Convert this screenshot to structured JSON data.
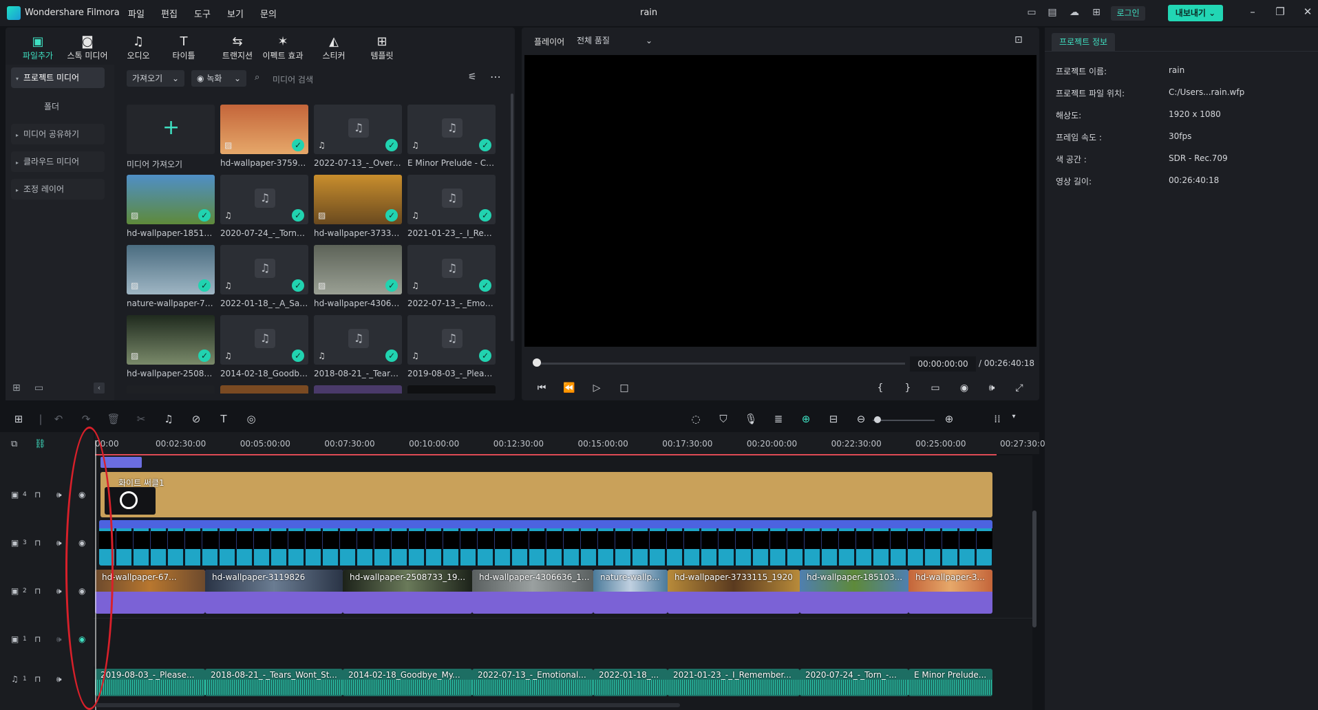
{
  "titlebar": {
    "app_name": "Wondershare Filmora",
    "menus": [
      "파일",
      "편집",
      "도구",
      "보기",
      "문의"
    ],
    "project_title": "rain",
    "login": "로그인",
    "export": "내보내기 ⌄"
  },
  "media_tabs": [
    {
      "label": "파일추가",
      "icon": "media-icon",
      "glyph": "▣"
    },
    {
      "label": "스톡 미디어",
      "icon": "stock-icon",
      "glyph": "◙"
    },
    {
      "label": "오디오",
      "icon": "music-icon",
      "glyph": "♫"
    },
    {
      "label": "타이틀",
      "icon": "title-icon",
      "glyph": "T"
    },
    {
      "label": "트랜지션",
      "icon": "transition-icon",
      "glyph": "⇆"
    },
    {
      "label": "이펙트 효과",
      "icon": "effects-icon",
      "glyph": "✶"
    },
    {
      "label": "스티커",
      "icon": "sticker-icon",
      "glyph": "◭"
    },
    {
      "label": "템플릿",
      "icon": "template-icon",
      "glyph": "⊞"
    }
  ],
  "sidebar": {
    "project_media": "프로젝트 미디어",
    "folder": "폴더",
    "items": [
      "미디어 공유하기",
      "클라우드 미디어",
      "조정 레이어"
    ]
  },
  "media_toolbar": {
    "import": "가져오기",
    "record": "녹화",
    "search_placeholder": "미디어 검색"
  },
  "media_items": [
    {
      "title": "미디어 가져오기",
      "kind": "import"
    },
    {
      "title": "hd-wallpaper-375957...",
      "kind": "image",
      "colors": [
        "#c4653a",
        "#e6a86a"
      ]
    },
    {
      "title": "2022-07-13_-_Overc...",
      "kind": "audio"
    },
    {
      "title": "E Minor Prelude - Ch...",
      "kind": "audio"
    },
    {
      "title": "hd-wallpaper-185103...",
      "kind": "image",
      "colors": [
        "#4f8fc7",
        "#5e8a3a"
      ]
    },
    {
      "title": "2020-07-24_-_Torn_-...",
      "kind": "audio"
    },
    {
      "title": "hd-wallpaper-373311...",
      "kind": "image",
      "colors": [
        "#c98e2d",
        "#6a4a1f"
      ]
    },
    {
      "title": "2021-01-23_-_I_Rem...",
      "kind": "audio"
    },
    {
      "title": "nature-wallpaper-746...",
      "kind": "image",
      "colors": [
        "#4a6c80",
        "#9fb6c4"
      ]
    },
    {
      "title": "2022-01-18_-_A_Sad...",
      "kind": "audio"
    },
    {
      "title": "hd-wallpaper-430663...",
      "kind": "image",
      "colors": [
        "#5d6358",
        "#9aa094"
      ]
    },
    {
      "title": "2022-07-13_-_Emoti...",
      "kind": "audio"
    },
    {
      "title": "hd-wallpaper-250873...",
      "kind": "image",
      "colors": [
        "#1f2a1e",
        "#7a8a6a"
      ]
    },
    {
      "title": "2014-02-18_Goodby...",
      "kind": "audio"
    },
    {
      "title": "2018-08-21_-_Tears_...",
      "kind": "audio"
    },
    {
      "title": "2019-08-03_-_Please...",
      "kind": "audio"
    }
  ],
  "player": {
    "label": "플레이어",
    "quality": "전체 품질",
    "current_time": "00:00:00:00",
    "total_time": "/  00:26:40:18"
  },
  "project_info": {
    "tab": "프로젝트 정보",
    "rows": [
      {
        "label": "프로젝트 이름:",
        "value": "rain"
      },
      {
        "label": "프로젝트 파일 위치:",
        "value": "C:/Users...rain.wfp"
      },
      {
        "label": "해상도:",
        "value": "1920 x 1080"
      },
      {
        "label": "프레임 속도 :",
        "value": "30fps"
      },
      {
        "label": "색 공간 :",
        "value": "SDR - Rec.709"
      },
      {
        "label": "영상 길이:",
        "value": "00:26:40:18"
      }
    ]
  },
  "ruler": [
    "00:00",
    "00:02:30:00",
    "00:05:00:00",
    "00:07:30:00",
    "00:10:00:00",
    "00:12:30:00",
    "00:15:00:00",
    "00:17:30:00",
    "00:20:00:00",
    "00:22:30:00",
    "00:25:00:00",
    "00:27:30:0"
  ],
  "tracks": {
    "title_clip": "화이트 써클1",
    "video_clips": [
      "hd-wallpaper-67...",
      "hd-wallpaper-3119826",
      "hd-wallpaper-2508733_19...",
      "hd-wallpaper-4306636_1...",
      "nature-wallp...",
      "hd-wallpaper-3733115_1920",
      "hd-wallpaper-185103...",
      "hd-wallpaper-3..."
    ],
    "audio_clips": [
      "2019-08-03_-_Please...",
      "2018-08-21_-_Tears_Wont_St...",
      "2014-02-18_Goodbye_My...",
      "2022-07-13_-_Emotional...",
      "2022-01-18_...",
      "2021-01-23_-_I_Remember...",
      "2020-07-24_-_Torn_-...",
      "E Minor Prelude..."
    ],
    "track_numbers": [
      "4",
      "3",
      "2",
      "1",
      "1"
    ]
  }
}
